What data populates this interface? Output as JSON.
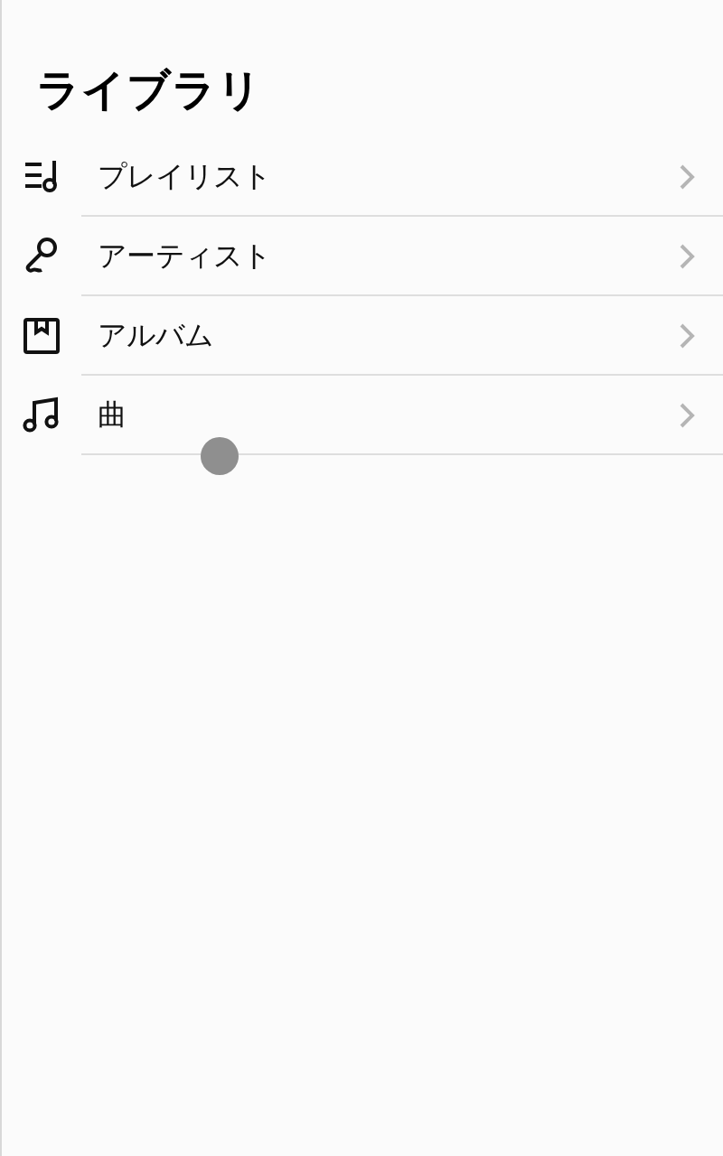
{
  "title": "ライブラリ",
  "items": [
    {
      "label": "プレイリスト"
    },
    {
      "label": "アーティスト"
    },
    {
      "label": "アルバム"
    },
    {
      "label": "曲"
    }
  ]
}
